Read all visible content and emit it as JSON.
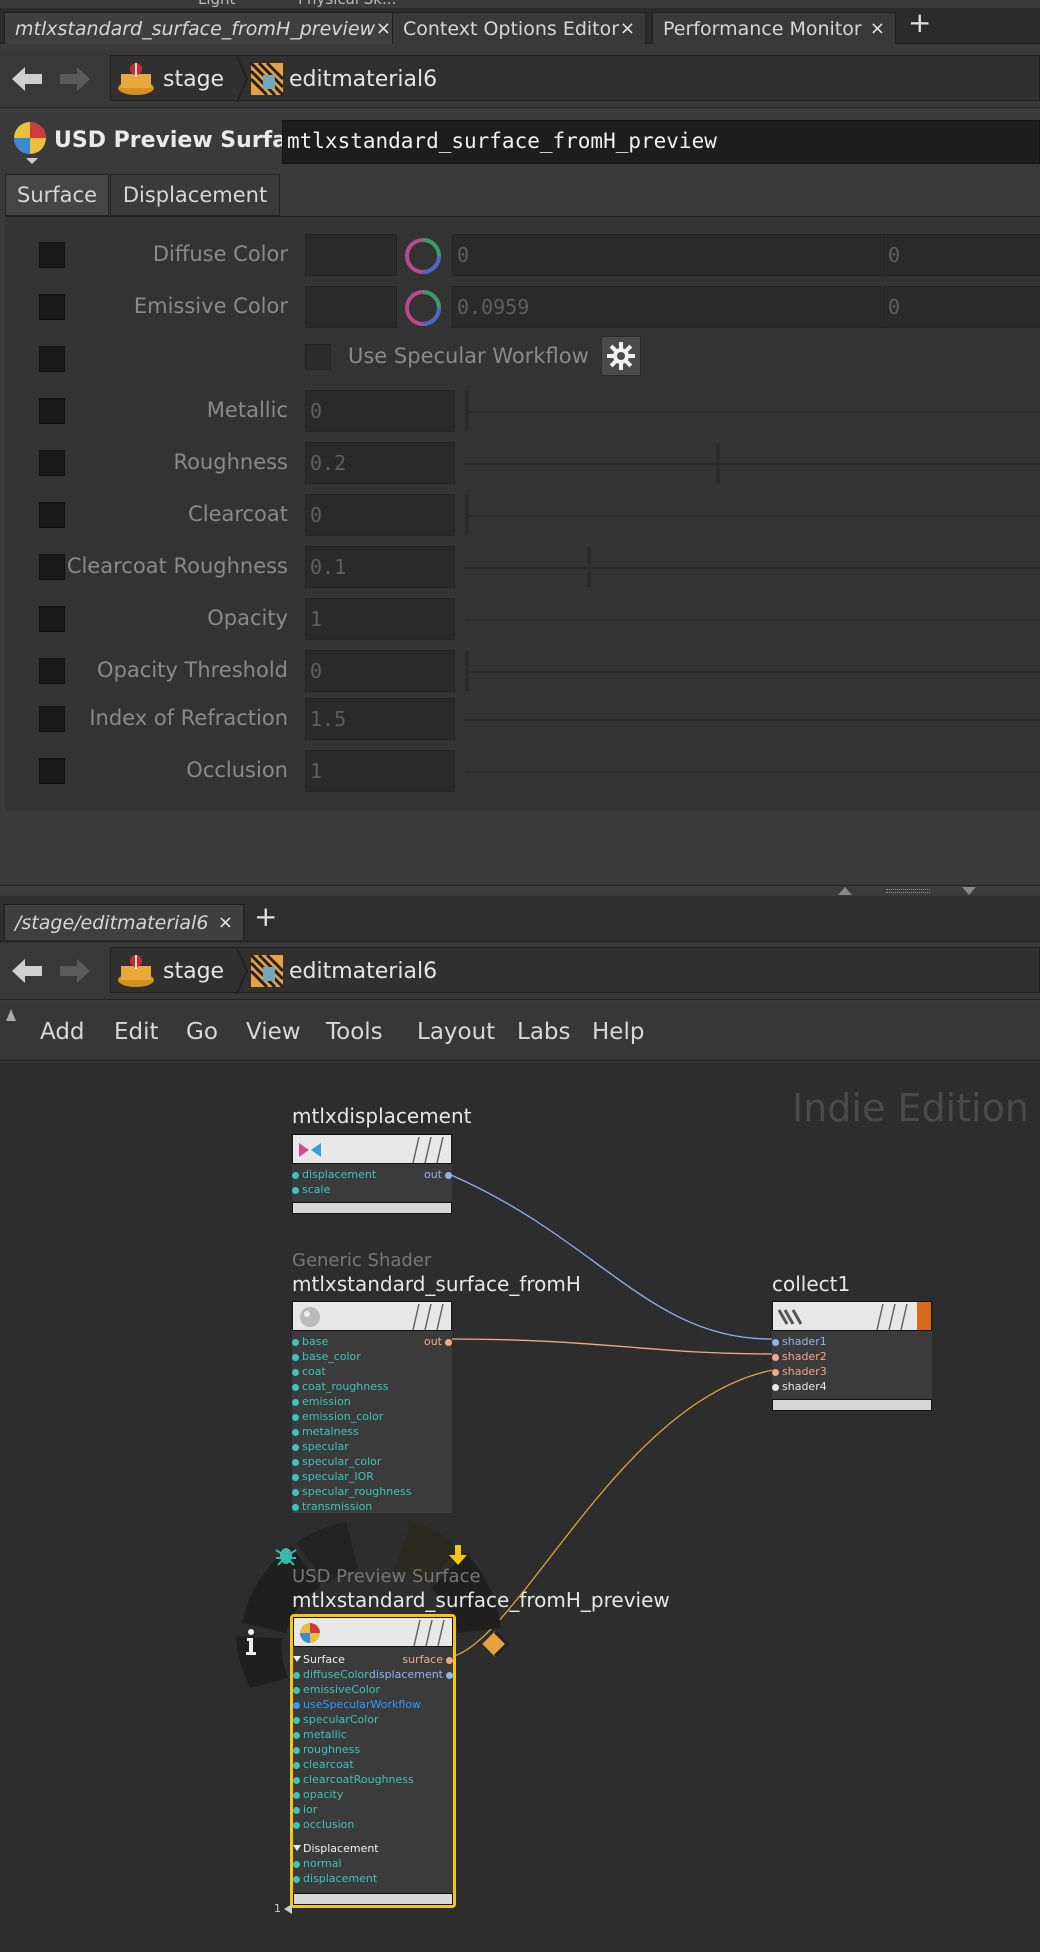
{
  "top_tabs": [
    {
      "label": "mtlxstandard_surface_fromH_preview",
      "close": "×"
    },
    {
      "label": "Context Options Editor",
      "close": "×"
    },
    {
      "label": "Performance Monitor",
      "close": "×"
    }
  ],
  "top_tab_add": "+",
  "cut_off_top_labels": [
    "Light",
    "Physical Sk..."
  ],
  "breadcrumb": {
    "items": [
      "stage",
      "editmaterial6"
    ]
  },
  "param_panel": {
    "node_type": "USD Preview Surface",
    "node_name": "mtlxstandard_surface_fromH_preview",
    "tabs": [
      "Surface",
      "Displacement"
    ],
    "params": {
      "diffuse_color": {
        "label": "Diffuse Color",
        "v1": "0",
        "v2": "0"
      },
      "emissive_color": {
        "label": "Emissive Color",
        "v1": "0.0959",
        "v2": "0"
      },
      "use_specular": {
        "label": "Use Specular Workflow"
      },
      "metallic": {
        "label": "Metallic",
        "value": "0"
      },
      "roughness": {
        "label": "Roughness",
        "value": "0.2"
      },
      "clearcoat": {
        "label": "Clearcoat",
        "value": "0"
      },
      "clearcoat_roughness": {
        "label": "Clearcoat Roughness",
        "value": "0.1"
      },
      "opacity": {
        "label": "Opacity",
        "value": "1"
      },
      "opacity_threshold": {
        "label": "Opacity Threshold",
        "value": "0"
      },
      "ior": {
        "label": "Index of Refraction",
        "value": "1.5"
      },
      "occlusion": {
        "label": "Occlusion",
        "value": "1"
      }
    }
  },
  "network_tabs": [
    {
      "label": "/stage/editmaterial6",
      "close": "×"
    }
  ],
  "network_tab_add": "+",
  "menu": [
    "Add",
    "Edit",
    "Go",
    "View",
    "Tools",
    "Layout",
    "Labs",
    "Help"
  ],
  "watermark": "Indie Edition",
  "nodes": {
    "mtlxdisplacement": {
      "name": "mtlxdisplacement",
      "inputs": [
        "displacement",
        "scale"
      ],
      "output": "out"
    },
    "standard_surface": {
      "type": "Generic Shader",
      "name": "mtlxstandard_surface_fromH",
      "inputs": [
        "base",
        "base_color",
        "coat",
        "coat_roughness",
        "emission",
        "emission_color",
        "metalness",
        "specular",
        "specular_color",
        "specular_IOR",
        "specular_roughness",
        "transmission"
      ],
      "output": "out"
    },
    "collect1": {
      "name": "collect1",
      "inputs": [
        "shader1",
        "shader2",
        "shader3",
        "shader4"
      ]
    },
    "preview": {
      "type": "USD Preview Surface",
      "name": "mtlxstandard_surface_fromH_preview",
      "group1": "Surface",
      "surface_inputs": [
        "diffuseColor",
        "emissiveColor",
        "useSpecularWorkflow",
        "specularColor",
        "metallic",
        "roughness",
        "clearcoat",
        "clearcoatRoughness",
        "opacity",
        "ior",
        "occlusion"
      ],
      "group2": "Displacement",
      "disp_inputs": [
        "normal",
        "displacement"
      ],
      "outputs": [
        "surface",
        "displacement"
      ]
    }
  },
  "page_indicator": "1",
  "colors": {
    "teal_port": "#3ec4b6",
    "blue_port": "#8fb3f0",
    "orange_port": "#f0a888",
    "selected": "#f5c518",
    "collect_accent": "#d8691c"
  }
}
